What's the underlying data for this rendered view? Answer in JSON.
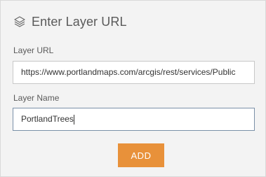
{
  "header": {
    "icon": "layers-icon",
    "title": "Enter Layer URL"
  },
  "form": {
    "url_label": "Layer URL",
    "url_value": "https://www.portlandmaps.com/arcgis/rest/services/Public",
    "name_label": "Layer Name",
    "name_value": "PortlandTrees"
  },
  "actions": {
    "add_label": "ADD"
  },
  "colors": {
    "accent": "#e8913a",
    "panel_background": "#f3f3f3",
    "focus_border": "#7a90a8"
  }
}
